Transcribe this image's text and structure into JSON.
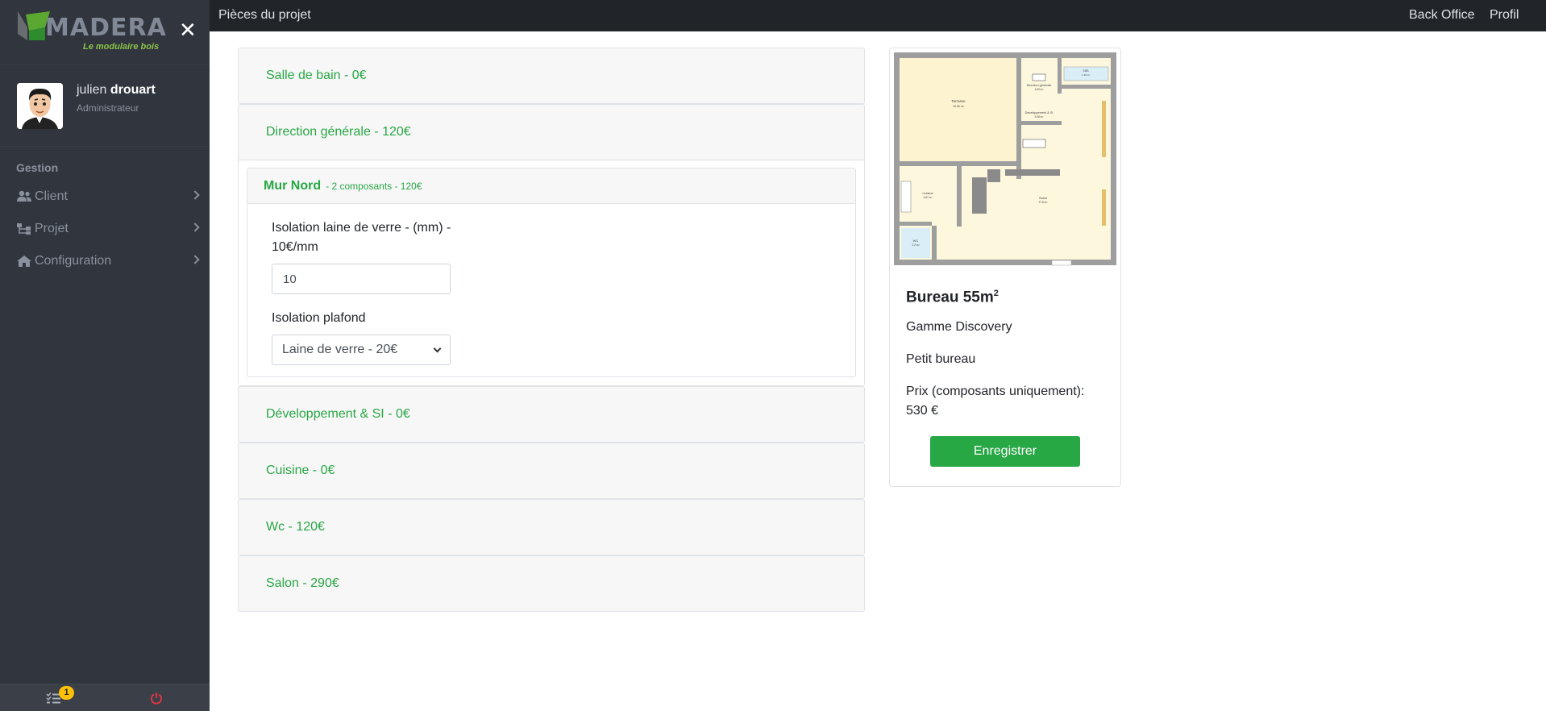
{
  "sidebar": {
    "brand": {
      "name": "MADERA",
      "tagline": "Le modulaire bois"
    },
    "close_symbol": "✕",
    "user": {
      "first_name": "julien",
      "last_name": "drouart",
      "role": "Administrateur"
    },
    "section_title": "Gestion",
    "nav": [
      {
        "label": "Client",
        "icon": "users-icon"
      },
      {
        "label": "Projet",
        "icon": "sitemap-icon"
      },
      {
        "label": "Configuration",
        "icon": "home-icon"
      }
    ],
    "footer": {
      "task_badge": "1",
      "task_icon": "tasks-icon",
      "power_icon": "power-icon"
    }
  },
  "topbar": {
    "title": "Pièces du projet",
    "links": [
      "Back Office",
      "Profil"
    ]
  },
  "rooms": [
    {
      "label": "Salle de bain - 0€"
    },
    {
      "label": "Direction générale - 120€"
    },
    {
      "label": "Développement & SI - 0€"
    },
    {
      "label": "Cuisine - 0€"
    },
    {
      "label": "Wc - 120€"
    },
    {
      "label": "Salon - 290€"
    }
  ],
  "expanded": {
    "wall_title": "Mur Nord",
    "wall_meta": "- 2 composants - 120€",
    "field1": {
      "label": "Isolation laine de verre - (mm) - 10€/mm",
      "value": "10"
    },
    "field2": {
      "label": "Isolation plafond",
      "selected": "Laine de verre - 20€"
    }
  },
  "product": {
    "title": "Bureau 55m",
    "title_sup": "2",
    "gamme": "Gamme Discovery",
    "description": "Petit bureau",
    "price_label": "Prix (composants uniquement):",
    "price_value": "530 €",
    "save_label": "Enregistrer",
    "plan_labels": {
      "terrasse": "Terrasse",
      "terrasse_area": "19.36 m²",
      "direction": "Direction générale",
      "direction_area": "4.83 m²",
      "sdb": "SDB",
      "sdb_area": "1.36 m²",
      "dev": "Développement & SI",
      "dev_area": "5.38 m²",
      "cuisine": "Cuisine",
      "cuisine_area": "5.87 m²",
      "salon": "Salon",
      "salon_area": "27.8 m²",
      "wc": "WC",
      "wc_area": "2.2 m²"
    }
  },
  "colors": {
    "accent": "#28a745",
    "sidebar": "#31353d",
    "topbar": "#212529",
    "badge": "#ffc107",
    "power": "#dc3545"
  }
}
